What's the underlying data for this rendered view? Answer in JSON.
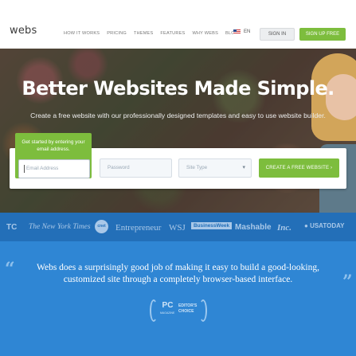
{
  "nav": {
    "logo": "webs",
    "links": [
      "HOW IT WORKS",
      "PRICING",
      "THEMES",
      "FEATURES",
      "WHY WEBS",
      "BLOG"
    ],
    "language": "EN",
    "signin_label": "SIGN IN",
    "signup_label": "SIGN UP FREE"
  },
  "hero": {
    "title": "Better Websites Made Simple.",
    "subtitle": "Create a free website with our professionally designed templates and easy to use website builder."
  },
  "signup_form": {
    "tip": "Get started by entering your email address.",
    "email_placeholder": "Email Address",
    "password_placeholder": "Password",
    "site_type_placeholder": "Site Type",
    "create_label": "CREATE A FREE WEBSITE ›"
  },
  "press": {
    "logos": [
      "TC",
      "The New York Times",
      "cnet",
      "Entrepreneur",
      "WSJ",
      "BusinessWeek",
      "Mashable",
      "Inc.",
      "USATODAY"
    ]
  },
  "quote": {
    "text": "Webs does a surprisingly good job of making it easy to build a good-looking, customized site through a completely browser-based interface.",
    "badge_brand": "PC",
    "badge_sub": "MAGAZINE",
    "badge_award": "EDITOR'S CHOICE"
  }
}
